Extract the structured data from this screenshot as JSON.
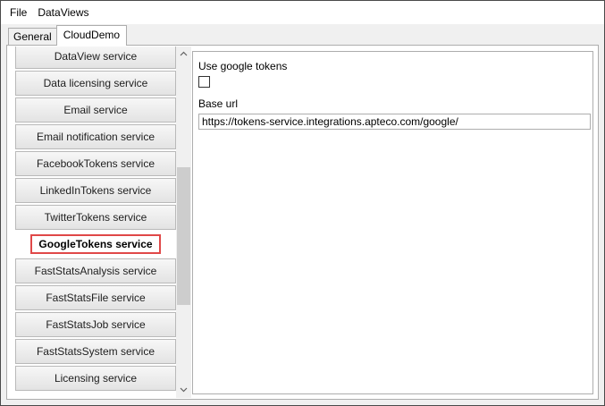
{
  "menubar": {
    "items": [
      {
        "label": "File"
      },
      {
        "label": "DataViews"
      }
    ]
  },
  "tabs": [
    {
      "label": "General",
      "active": false
    },
    {
      "label": "CloudDemo",
      "active": true
    }
  ],
  "services": {
    "items": [
      {
        "label": "DataView service",
        "selected": false
      },
      {
        "label": "Data licensing service",
        "selected": false
      },
      {
        "label": "Email service",
        "selected": false
      },
      {
        "label": "Email notification service",
        "selected": false
      },
      {
        "label": "FacebookTokens service",
        "selected": false
      },
      {
        "label": "LinkedInTokens service",
        "selected": false
      },
      {
        "label": "TwitterTokens service",
        "selected": false
      },
      {
        "label": "GoogleTokens service",
        "selected": true
      },
      {
        "label": "FastStatsAnalysis service",
        "selected": false
      },
      {
        "label": "FastStatsFile service",
        "selected": false
      },
      {
        "label": "FastStatsJob service",
        "selected": false
      },
      {
        "label": "FastStatsSystem service",
        "selected": false
      },
      {
        "label": "Licensing service",
        "selected": false
      }
    ]
  },
  "scrollbar": {
    "up_icon": "chevron-up-icon",
    "down_icon": "chevron-down-icon"
  },
  "detail": {
    "use_tokens_label": "Use google tokens",
    "use_tokens_checked": false,
    "base_url_label": "Base url",
    "base_url_value": "https://tokens-service.integrations.apteco.com/google/"
  },
  "colors": {
    "highlight_border": "#e04848",
    "window_bg": "#f0f0f0",
    "panel_bg": "#ffffff"
  }
}
